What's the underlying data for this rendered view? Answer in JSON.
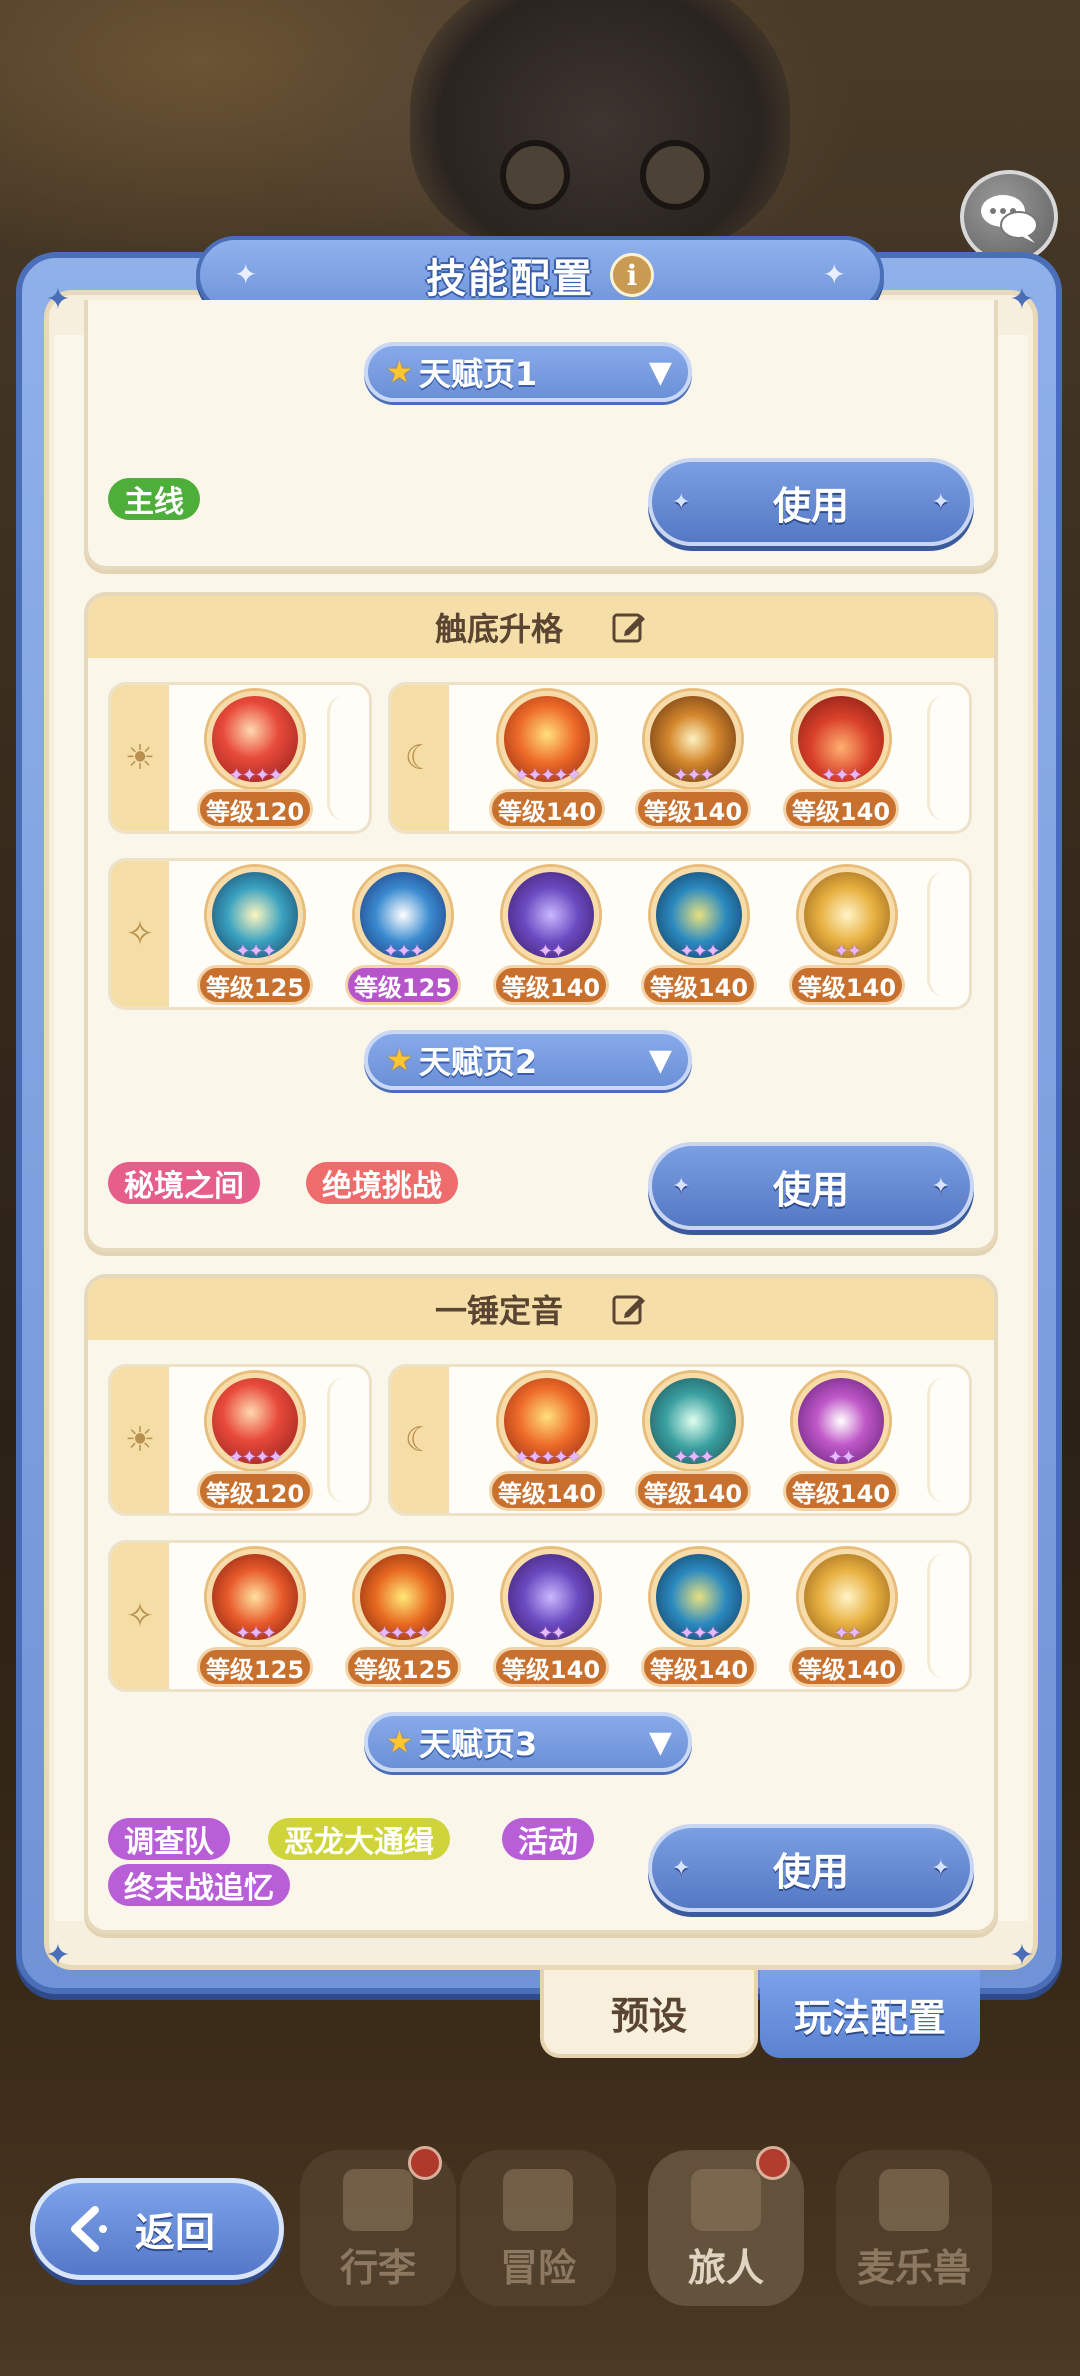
{
  "panel": {
    "title": "技能配置",
    "info_icon": "i"
  },
  "card1": {
    "talent_label": "天赋页1",
    "tags": [
      "主线"
    ],
    "use_label": "使用"
  },
  "card2": {
    "title": "触底升格",
    "group_a": {
      "icon": "sun-icon",
      "skills": [
        {
          "level": "等级120",
          "orb": "red"
        }
      ]
    },
    "group_b": {
      "icon": "moon-icon",
      "skills": [
        {
          "level": "等级140",
          "orb": "fire"
        },
        {
          "level": "等级140",
          "orb": "swirl"
        },
        {
          "level": "等级140",
          "orb": "flame"
        }
      ]
    },
    "group_c": {
      "icon": "star-icon",
      "skills": [
        {
          "level": "等级125",
          "orb": "cyan"
        },
        {
          "level": "等级125",
          "orb": "tide",
          "badge": "purple"
        },
        {
          "level": "等级140",
          "orb": "violet"
        },
        {
          "level": "等级140",
          "orb": "storm"
        },
        {
          "level": "等级140",
          "orb": "gold"
        }
      ]
    },
    "talent_label": "天赋页2",
    "tags": [
      "秘境之间",
      "绝境挑战"
    ],
    "use_label": "使用"
  },
  "card3": {
    "title": "一锤定音",
    "group_a": {
      "icon": "sun-icon",
      "skills": [
        {
          "level": "等级120",
          "orb": "red"
        }
      ]
    },
    "group_b": {
      "icon": "moon-icon",
      "skills": [
        {
          "level": "等级140",
          "orb": "fire"
        },
        {
          "level": "等级140",
          "orb": "shield"
        },
        {
          "level": "等级140",
          "orb": "target"
        }
      ]
    },
    "group_c": {
      "icon": "star-icon",
      "skills": [
        {
          "level": "等级125",
          "orb": "ember"
        },
        {
          "level": "等级125",
          "orb": "bolt"
        },
        {
          "level": "等级140",
          "orb": "violet"
        },
        {
          "level": "等级140",
          "orb": "storm"
        },
        {
          "level": "等级140",
          "orb": "gold"
        }
      ]
    },
    "talent_label": "天赋页3",
    "tags": [
      "调查队",
      "恶龙大通缉",
      "活动",
      "终末战追忆"
    ],
    "use_label": "使用"
  },
  "tabs": {
    "preset": "预设",
    "play_config": "玩法配置"
  },
  "nav": {
    "back": "返回",
    "items": [
      "行李",
      "冒险",
      "旅人",
      "麦乐兽"
    ]
  },
  "colors": {
    "accent_blue": "#6f94d8",
    "level_badge": "#c8702e",
    "tag_green": "#4dae3a"
  }
}
